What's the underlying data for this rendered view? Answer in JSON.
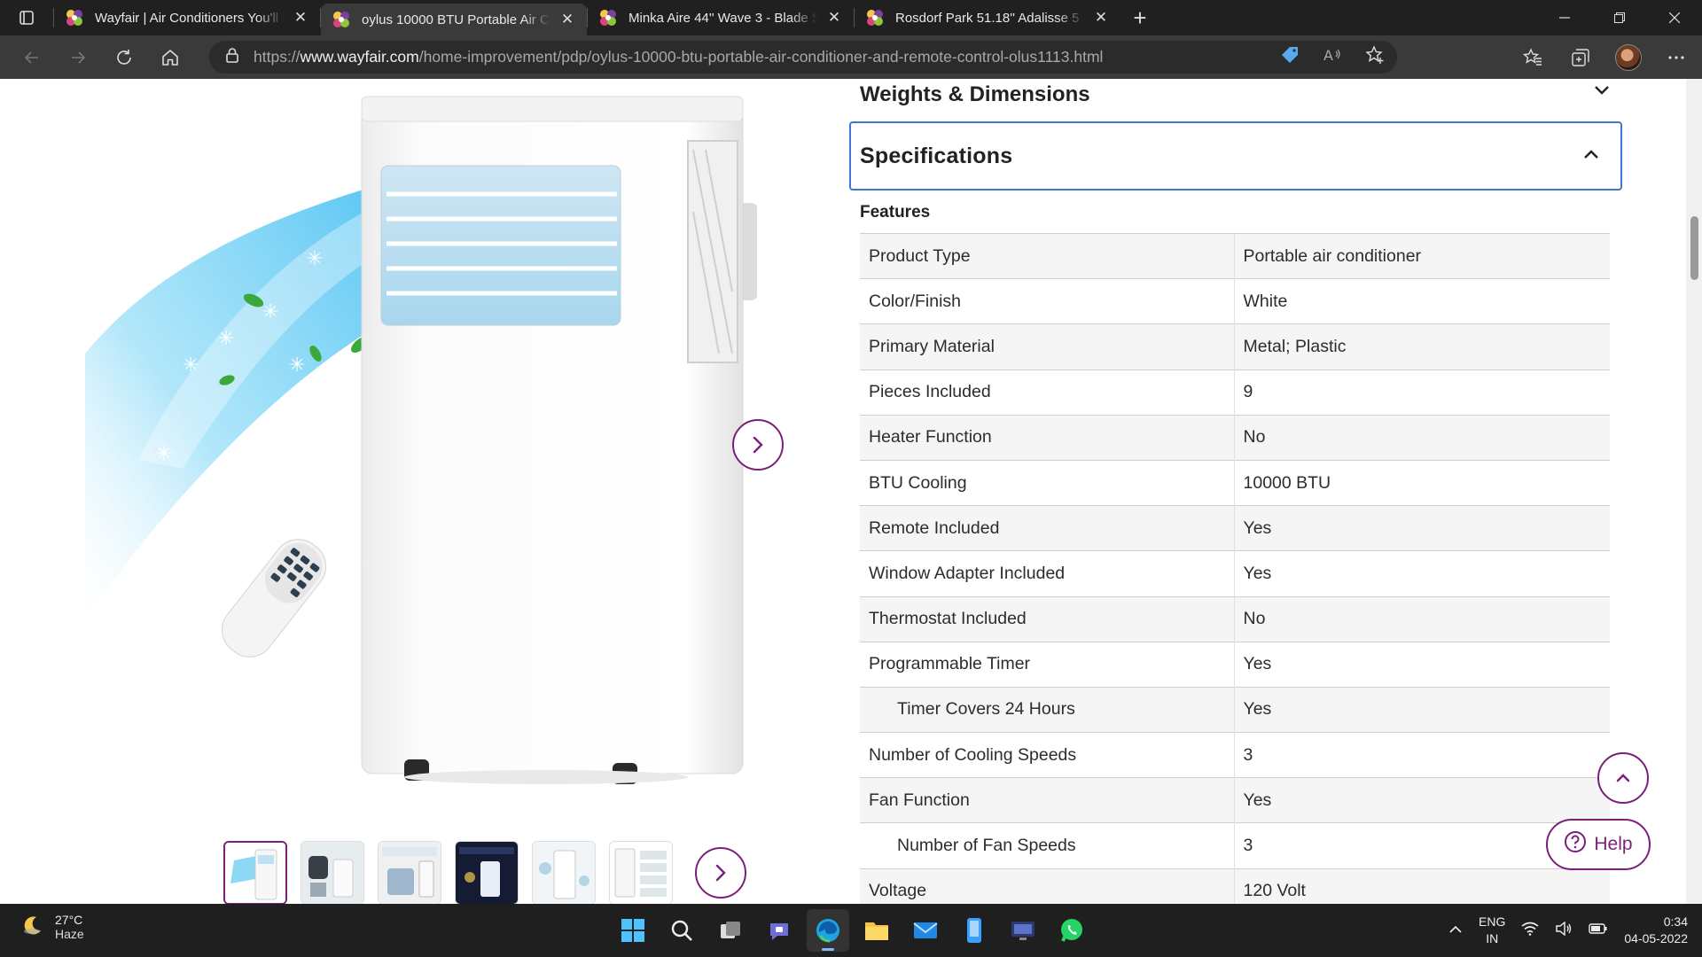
{
  "browser": {
    "tabs": [
      {
        "title": "Wayfair | Air Conditioners You'll Love",
        "active": false
      },
      {
        "title": "oylus 10000 BTU Portable Air Conditioner",
        "active": true
      },
      {
        "title": "Minka Aire 44'' Wave 3 - Blade Standard",
        "active": false
      },
      {
        "title": "Rosdorf Park 51.18'' Adalisse 5 - Blade",
        "active": false
      }
    ],
    "url_prefix": "https://",
    "url_host": "www.wayfair.com",
    "url_path": "/home-improvement/pdp/oylus-10000-btu-portable-air-conditioner-and-remote-control-olus1113.html"
  },
  "accordion": {
    "weights_title": "Weights & Dimensions",
    "spec_title": "Specifications"
  },
  "features_heading": "Features",
  "specs": [
    {
      "key": "Product Type",
      "value": "Portable air conditioner",
      "sub": false
    },
    {
      "key": "Color/Finish",
      "value": "White",
      "sub": false
    },
    {
      "key": "Primary Material",
      "value": "Metal; Plastic",
      "sub": false
    },
    {
      "key": "Pieces Included",
      "value": "9",
      "sub": false
    },
    {
      "key": "Heater Function",
      "value": "No",
      "sub": false
    },
    {
      "key": "BTU Cooling",
      "value": "10000 BTU",
      "sub": false
    },
    {
      "key": "Remote Included",
      "value": "Yes",
      "sub": false
    },
    {
      "key": "Window Adapter Included",
      "value": "Yes",
      "sub": false
    },
    {
      "key": "Thermostat Included",
      "value": "No",
      "sub": false
    },
    {
      "key": "Programmable Timer",
      "value": "Yes",
      "sub": false
    },
    {
      "key": "Timer Covers 24 Hours",
      "value": "Yes",
      "sub": true
    },
    {
      "key": "Number of Cooling Speeds",
      "value": "3",
      "sub": false
    },
    {
      "key": "Fan Function",
      "value": "Yes",
      "sub": false
    },
    {
      "key": "Number of Fan Speeds",
      "value": "3",
      "sub": true
    },
    {
      "key": "Voltage",
      "value": "120 Volt",
      "sub": false
    }
  ],
  "help_label": "Help",
  "taskbar": {
    "temperature": "27°C",
    "condition": "Haze",
    "lang_line1": "ENG",
    "lang_line2": "IN",
    "time": "0:34",
    "date": "04-05-2022"
  },
  "colors": {
    "brand": "#7b1f7a",
    "focus_border": "#3c78d8"
  }
}
